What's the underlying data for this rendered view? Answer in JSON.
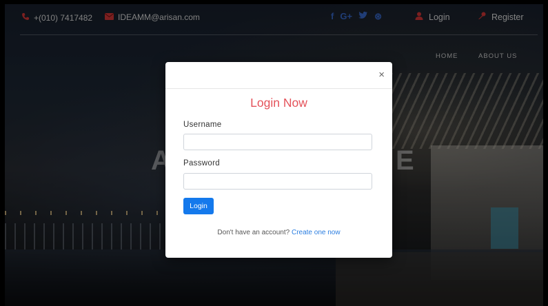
{
  "topbar": {
    "phone": "+(010) 7417482",
    "email": "IDEAMM@arisan.com",
    "social_icons": [
      "f",
      "G+",
      "🐦",
      "⊛"
    ],
    "login_label": "Login",
    "register_label": "Register"
  },
  "nav": {
    "home": "HOME",
    "about": "ABOUT US"
  },
  "hero": {
    "left_fragment": "A",
    "right_fragment": "E"
  },
  "modal": {
    "close_glyph": "×",
    "title": "Login Now",
    "username_label": "Username",
    "username_value": "",
    "password_label": "Password",
    "password_value": "",
    "submit_label": "Login",
    "footer_text": "Don't have an account? ",
    "footer_link": "Create one now"
  },
  "colors": {
    "accent_red": "#e4525a",
    "primary_blue": "#1479ec",
    "link_blue": "#2a7de0",
    "social_blue": "#3b6fd8"
  }
}
